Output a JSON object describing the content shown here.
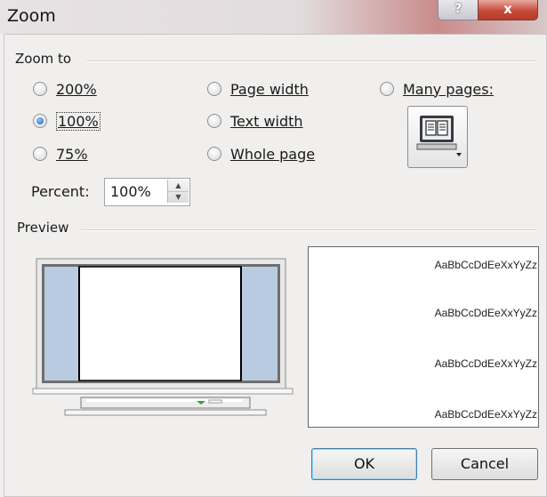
{
  "window": {
    "title": "Zoom",
    "help_label": "?",
    "close_label": "x"
  },
  "zoom_to": {
    "label": "Zoom to",
    "options": [
      {
        "label": "200%",
        "checked": false
      },
      {
        "label": "100%",
        "checked": true
      },
      {
        "label": "75%",
        "checked": false
      },
      {
        "label": "Page width",
        "checked": false
      },
      {
        "label": "Text width",
        "checked": false
      },
      {
        "label": "Whole page",
        "checked": false
      },
      {
        "label": "Many pages:",
        "checked": false
      }
    ],
    "many_pages_icon": "monitor-pages-icon"
  },
  "percent": {
    "label": "Percent:",
    "value": "100%"
  },
  "preview": {
    "label": "Preview",
    "sample_text": [
      "AaBbCcDdEeXxYyZz",
      "AaBbCcDdEeXxYyZz",
      "AaBbCcDdEeXxYyZz",
      "AaBbCcDdEeXxYyZz"
    ]
  },
  "buttons": {
    "ok": "OK",
    "cancel": "Cancel"
  },
  "colors": {
    "selected_radio": "#1e5fb8",
    "preview_side": "#b9cbe0",
    "close_button": "#c54c3b"
  }
}
